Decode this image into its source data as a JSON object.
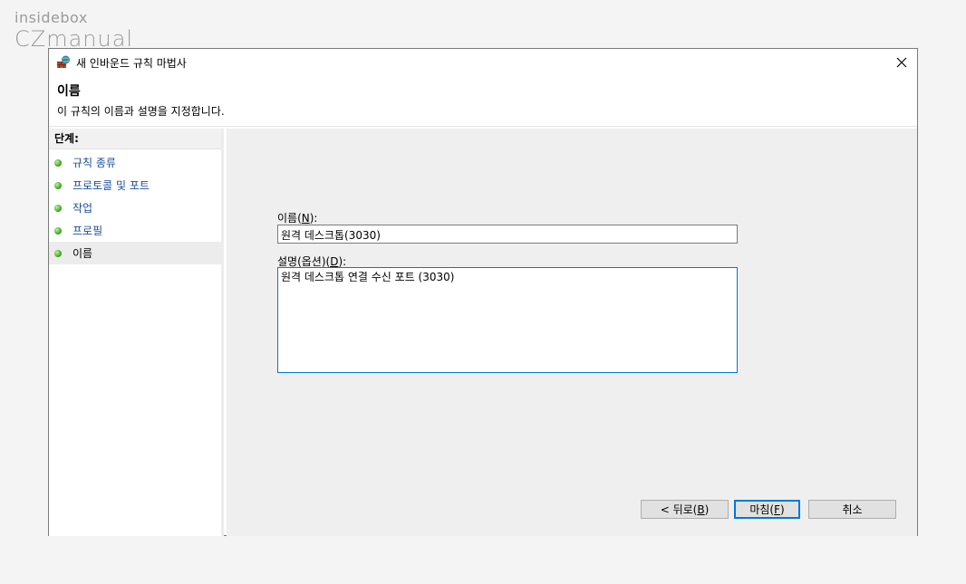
{
  "watermark": {
    "line1": "insidebox",
    "line2": "CZmanual"
  },
  "window": {
    "title": "새 인바운드 규칙 마법사",
    "close_label": "✕"
  },
  "header": {
    "title": "이름",
    "subtitle": "이 규칙의 이름과 설명을 지정합니다."
  },
  "steps": {
    "header": "단계:",
    "items": [
      {
        "label": "규칙 종류"
      },
      {
        "label": "프로토콜 및 포트"
      },
      {
        "label": "작업"
      },
      {
        "label": "프로필"
      },
      {
        "label": "이름",
        "current": true
      }
    ]
  },
  "form": {
    "name_label_pre": "이름(",
    "name_label_mn": "N",
    "name_label_post": "):",
    "name_value": "원격 데스크톱(3030)",
    "desc_label_pre": "설명(옵션)(",
    "desc_label_mn": "D",
    "desc_label_post": "):",
    "desc_value": "원격 데스크톱 연결 수신 포트 (3030)"
  },
  "buttons": {
    "back_pre": "< 뒤로(",
    "back_mn": "B",
    "back_post": ")",
    "finish_pre": "마침(",
    "finish_mn": "F",
    "finish_post": ")",
    "cancel": "취소"
  },
  "colors": {
    "accent": "#0078d7",
    "step_link": "#1a4e9b",
    "step_dot": "#3aa51c"
  }
}
